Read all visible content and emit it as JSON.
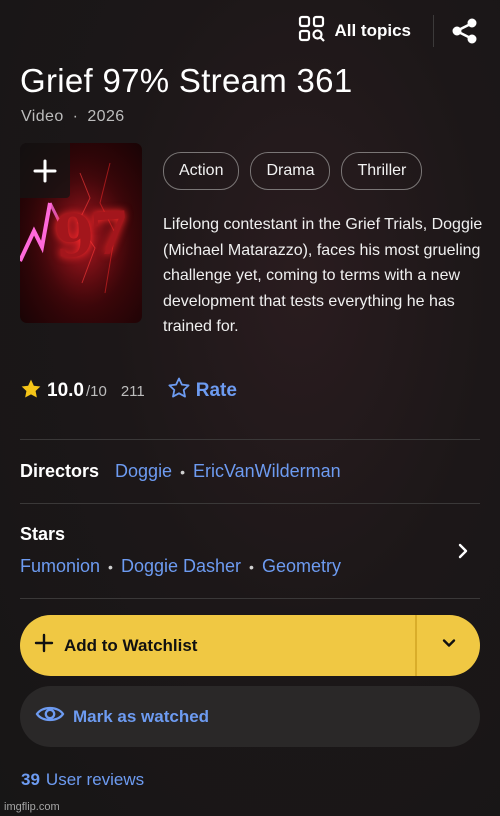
{
  "header": {
    "all_topics_label": "All topics",
    "icons": {
      "topics": "topics-grid-search-icon",
      "share": "share-icon"
    }
  },
  "title": "Grief 97% Stream 361",
  "meta": {
    "type": "Video",
    "separator": "·",
    "year": "2026"
  },
  "poster": {
    "add_icon": "plus-icon",
    "art_text": "97"
  },
  "genres": [
    "Action",
    "Drama",
    "Thriller"
  ],
  "plot": "Lifelong contestant in the Grief Trials, Doggie (Michael Matarazzo), faces his most grueling challenge yet, coming to terms with a new development that tests everything he has trained for.",
  "rating": {
    "score": "10.0",
    "out_of": "/10",
    "votes": "211",
    "rate_label": "Rate",
    "star_color": "#f5c518"
  },
  "directors": {
    "label": "Directors",
    "names": [
      "Doggie",
      "EricVanWilderman"
    ]
  },
  "stars": {
    "label": "Stars",
    "names": [
      "Fumonion",
      "Doggie Dasher",
      "Geometry"
    ]
  },
  "actions": {
    "watchlist_label": "Add to Watchlist",
    "watched_label": "Mark as watched"
  },
  "reviews": {
    "count": "39",
    "label": "User reviews"
  },
  "watermark": "imgflip.com",
  "colors": {
    "accent": "#6d9bf1",
    "watchlist_bg": "#f0c843",
    "background": "#1c1718"
  }
}
